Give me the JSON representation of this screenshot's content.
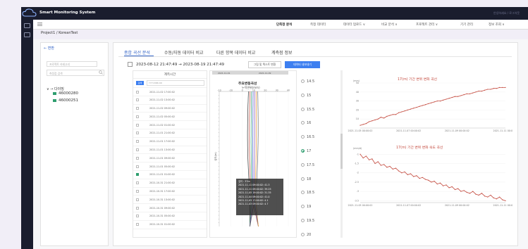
{
  "app": {
    "title": "Smart Monitoring System",
    "user_text": "안녕하세요 / 로그아웃"
  },
  "nav": {
    "items": [
      {
        "label": "단측정 분석"
      },
      {
        "label": "측정 데이터"
      },
      {
        "label": "데이터 업로드 ∨"
      },
      {
        "label": "비교 분석 ∨"
      },
      {
        "label": "프로젝트 관리 ∨"
      },
      {
        "label": "기기 관리"
      },
      {
        "label": "정보 조회 ∨"
      }
    ]
  },
  "breadcrumb": "Project1 / KoreanTest",
  "sidebar": {
    "back_label": "← 변환",
    "select_placeholder": "프로젝트 카테고리",
    "search_placeholder": "측정점 검색",
    "tree_root": "다이밍",
    "tree_leaves": [
      "46000280",
      "46000251"
    ]
  },
  "tabs": [
    {
      "label": "종합 곡선 분석",
      "active": true
    },
    {
      "label": "수동/자동 데이터 비교",
      "active": false
    },
    {
      "label": "다른 항목 데이터 비교",
      "active": false
    },
    {
      "label": "계측점 정보",
      "active": false
    }
  ],
  "toolbar": {
    "start": "2023-08-12 21:47:49",
    "arrow": "→",
    "end": "2023-08-19 21:47:49",
    "btn_outline": "그림 및 텍스트 변환",
    "btn_blue": "데이터 내보내기"
  },
  "list": {
    "header": "계측시간",
    "search_btn": "검색",
    "search_value": "YYYY-MM-DD",
    "rows": [
      {
        "date": "2021-11-02 17:00:02",
        "checked": false
      },
      {
        "date": "2021-11-02 13:00:02",
        "checked": false
      },
      {
        "date": "2021-11-02 09:00:02",
        "checked": false
      },
      {
        "date": "2021-11-02 05:00:02",
        "checked": false
      },
      {
        "date": "2021-11-02 01:00:02",
        "checked": false
      },
      {
        "date": "2021-11-01 21:00:02",
        "checked": false
      },
      {
        "date": "2021-11-01 17:00:02",
        "checked": false
      },
      {
        "date": "2021-11-01 13:00:02",
        "checked": false
      },
      {
        "date": "2021-11-01 09:00:02",
        "checked": false
      },
      {
        "date": "2021-11-01 05:00:02",
        "checked": false
      },
      {
        "date": "2021-11-01 01:00:02",
        "checked": true
      },
      {
        "date": "2021-10-31 21:00:02",
        "checked": false
      },
      {
        "date": "2021-10-31 17:00:02",
        "checked": false
      },
      {
        "date": "2021-10-31 13:00:02",
        "checked": false
      },
      {
        "date": "2021-10-31 09:00:02",
        "checked": false
      },
      {
        "date": "2021-10-31 05:00:02",
        "checked": false
      },
      {
        "date": "2021-10-31 01:00:02",
        "checked": false
      }
    ]
  },
  "depth_chart": {
    "title": "주요변동곡선",
    "subtitle": "누적변위(mm)",
    "x_ticks": [
      "-10",
      "-20",
      "0",
      "10",
      "20",
      "30",
      "40"
    ],
    "y_axis_label": "심도(m)",
    "date_from": "2021-11-01",
    "date_to": "2021-11-09",
    "tooltip": [
      "깊이 : 37m",
      "2021-11-11 09:00:02: 41.3",
      "2021-11-11 09:00:02: 39.25",
      "2021-11-05 19:00:02: 31.35",
      "2021-11-04 09:00:02: 41.0",
      "2021-11-03 17:00:02: 4.1",
      "2021-11-03 09:00:02: 4.7"
    ]
  },
  "depths": [
    {
      "label": "14.5",
      "selected": false
    },
    {
      "label": "15",
      "selected": false
    },
    {
      "label": "15.5",
      "selected": false
    },
    {
      "label": "16",
      "selected": false
    },
    {
      "label": "16.5",
      "selected": false
    },
    {
      "label": "17",
      "selected": true
    },
    {
      "label": "17.5",
      "selected": false
    },
    {
      "label": "18",
      "selected": false
    },
    {
      "label": "18.5",
      "selected": false
    },
    {
      "label": "19",
      "selected": false
    },
    {
      "label": "19.5",
      "selected": false
    },
    {
      "label": "20",
      "selected": false
    }
  ],
  "colors": {
    "accent": "#3565c7",
    "button": "#3d7ff0",
    "brand_dark": "#1a1d2e",
    "line_red": "#c44a3e",
    "check_green": "#2f9e6f"
  },
  "chart_data": [
    {
      "type": "line",
      "title": "17(m) 기간 변위 변화 곡선",
      "ylabel": "(mm)",
      "x_ticks": [
        "2021-11-05 00:00:02",
        "2021-11-07 00:00:02",
        "2021-11-09 00:00:02",
        "2021-11-11 00:00:02"
      ],
      "y_ticks": [
        10,
        20,
        30,
        40,
        50
      ],
      "ylim": [
        0,
        50
      ],
      "values": [
        3,
        4,
        5,
        7,
        8,
        9,
        10,
        12,
        11,
        13,
        14,
        15,
        15,
        17,
        18,
        19,
        20,
        21,
        22,
        23,
        24,
        25,
        26,
        27,
        28,
        29,
        30,
        30,
        31,
        32,
        33,
        34,
        35,
        35,
        36,
        37,
        38,
        38,
        39,
        40,
        41,
        41,
        42,
        43,
        43,
        44,
        44,
        45,
        45,
        45
      ]
    },
    {
      "type": "line",
      "title": "17(m) 기간 변위 변화 속도 곡선",
      "ylabel": "(mm/d)",
      "x_ticks": [
        "2021-11-05 00:00:02",
        "2021-11-07 00:00:02",
        "2021-11-09 00:00:02",
        "2021-11-11 00:00:02"
      ],
      "y_ticks": [
        -1.0,
        -1.5,
        -2.0,
        -2.5,
        -3.0,
        -3.5
      ],
      "ylim": [
        -3.6,
        -0.8
      ],
      "values": [
        -1.0,
        -1.2,
        -1.1,
        -1.3,
        -1.25,
        -1.5,
        -1.4,
        -1.6,
        -1.55,
        -1.7,
        -1.65,
        -1.8,
        -1.75,
        -1.9,
        -2.0,
        -1.95,
        -2.1,
        -2.05,
        -2.2,
        -2.15,
        -2.3,
        -2.25,
        -2.35,
        -2.4,
        -2.5,
        -2.45,
        -2.6,
        -2.55,
        -2.7,
        -2.65,
        -2.8,
        -2.75,
        -2.9,
        -2.85,
        -3.0,
        -2.95,
        -3.05,
        -3.1,
        -3.0,
        -3.15,
        -3.2,
        -3.1,
        -3.25,
        -3.3,
        -3.2,
        -3.35,
        -3.4,
        -3.3,
        -3.45,
        -3.5
      ]
    }
  ]
}
